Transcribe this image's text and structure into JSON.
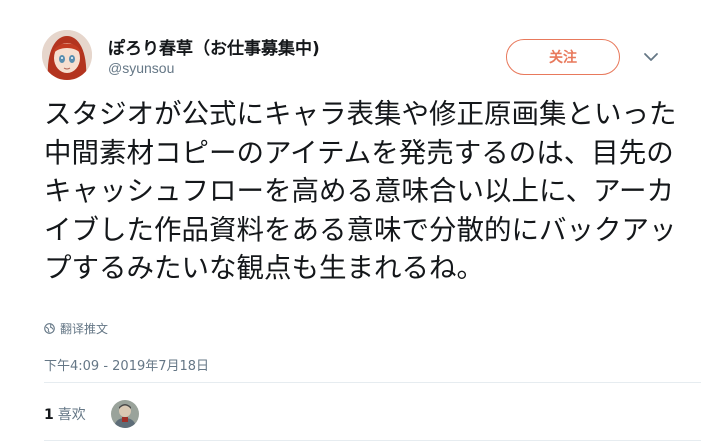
{
  "user": {
    "display_name": "ぽろり春草（お仕事募集中)",
    "handle": "@syunsou",
    "follow_label": "关注"
  },
  "tweet": {
    "text": "スタジオが公式にキャラ表集や修正原画集といった中間素材コピーのアイテムを発売するのは、目先のキャッシュフローを高める意味合い以上に、アーカイブした作品資料をある意味で分散的にバックアップするみたいな観点も生まれるね。",
    "translate_label": "翻译推文",
    "timestamp": "下午4:09 - 2019年7月18日"
  },
  "stats": {
    "like_count": "1",
    "like_label": "喜欢"
  },
  "colors": {
    "follow_accent": "#e8795c",
    "secondary_text": "#657786",
    "divider": "#e6ecf0"
  }
}
